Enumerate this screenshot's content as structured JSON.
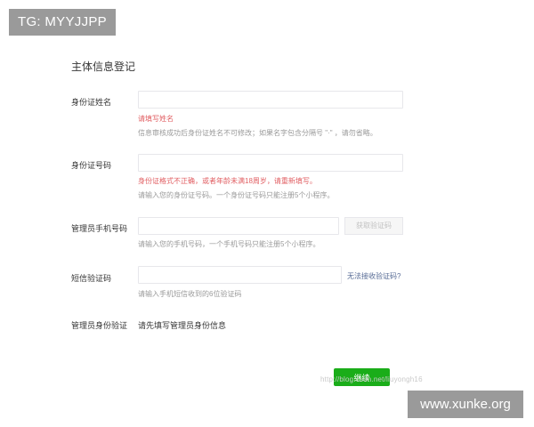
{
  "watermarks": {
    "top_left": "TG: MYYJJPP",
    "bottom_right": "www.xunke.org",
    "url_text": "http://blog.csdn.net/liuyongh16"
  },
  "page": {
    "title": "主体信息登记"
  },
  "form": {
    "name": {
      "label": "身份证姓名",
      "value": "",
      "placeholder": "",
      "error": "请填写姓名",
      "hint": "信息审核成功后身份证姓名不可修改；如果名字包含分隔号 \"·\" ，请勿省略。"
    },
    "id_number": {
      "label": "身份证号码",
      "value": "",
      "placeholder": "",
      "error": "身份证格式不正确，或者年龄未满18周岁，请重新填写。",
      "hint": "请输入您的身份证号码。一个身份证号码只能注册5个小程序。"
    },
    "phone": {
      "label": "管理员手机号码",
      "value": "",
      "placeholder": "",
      "get_code_label": "获取验证码",
      "hint": "请输入您的手机号码，一个手机号码只能注册5个小程序。"
    },
    "sms_code": {
      "label": "短信验证码",
      "value": "",
      "placeholder": "",
      "link": "无法接收验证码?",
      "hint": "请输入手机短信收到的6位验证码"
    },
    "identity_verify": {
      "label": "管理员身份验证",
      "value": "请先填写管理员身份信息"
    }
  },
  "actions": {
    "continue_label": "继续"
  },
  "colors": {
    "primary": "#1aad19",
    "error": "#e15f63",
    "link": "#576b95",
    "hint": "#9a9a9a"
  }
}
